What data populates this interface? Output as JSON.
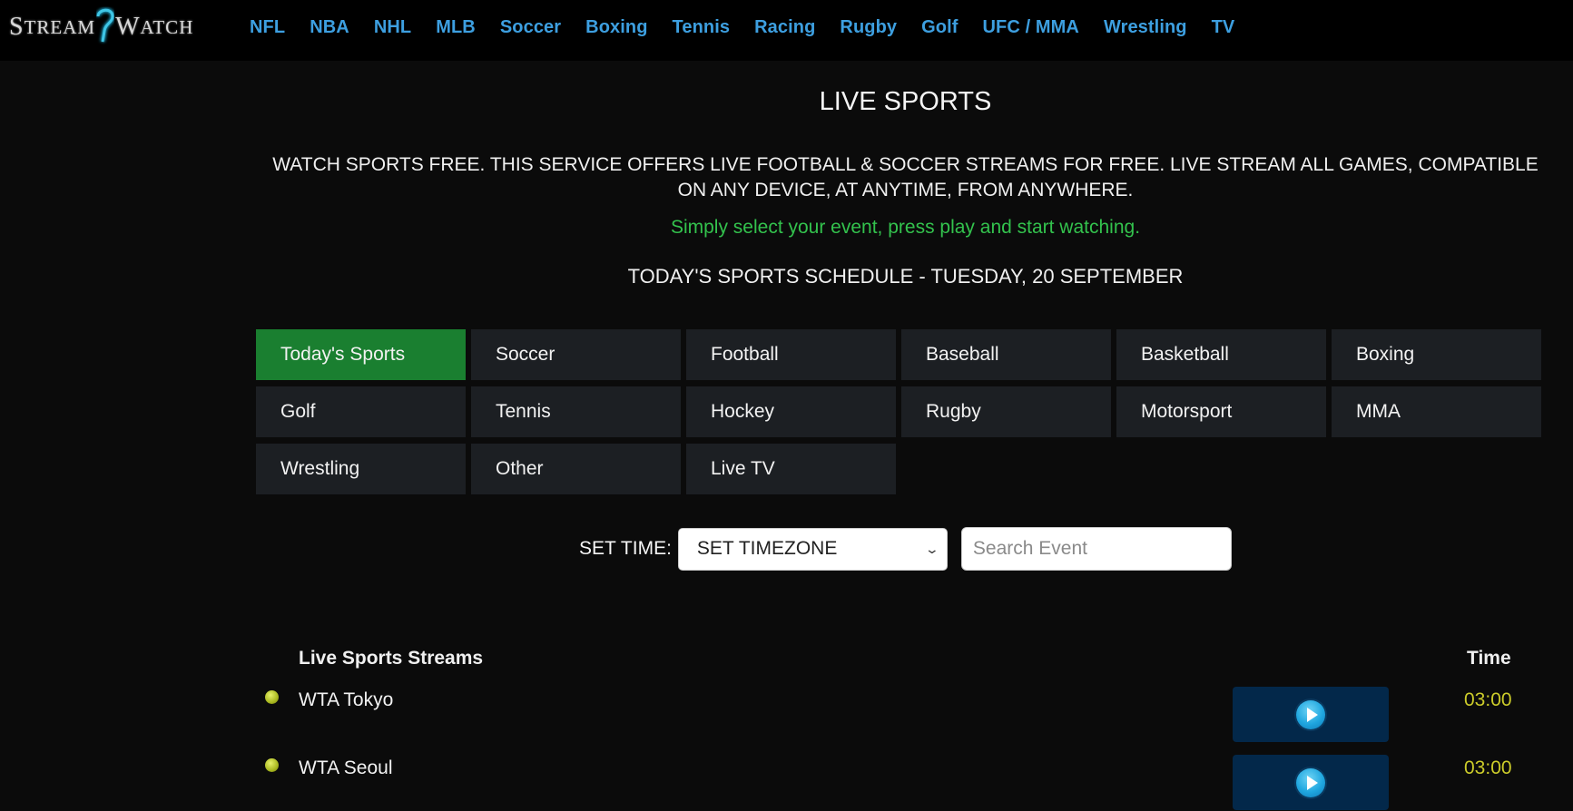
{
  "header": {
    "logo": {
      "part1_big": "S",
      "part1_small": "TREAM",
      "part2_big": "W",
      "part2_small": "ATCH"
    },
    "nav": [
      "NFL",
      "NBA",
      "NHL",
      "MLB",
      "Soccer",
      "Boxing",
      "Tennis",
      "Racing",
      "Rugby",
      "Golf",
      "UFC / MMA",
      "Wrestling",
      "TV"
    ]
  },
  "hero": {
    "title": "LIVE SPORTS",
    "intro": "WATCH SPORTS FREE. THIS SERVICE OFFERS LIVE FOOTBALL & SOCCER STREAMS FOR FREE. LIVE STREAM ALL GAMES, COMPATIBLE ON ANY DEVICE, AT ANYTIME, FROM ANYWHERE.",
    "tagline": "Simply select your event, press play and start watching.",
    "schedule": "TODAY'S SPORTS SCHEDULE - TUESDAY, 20 SEPTEMBER"
  },
  "categories": [
    {
      "label": "Today's Sports",
      "active": true
    },
    {
      "label": "Soccer"
    },
    {
      "label": "Football"
    },
    {
      "label": "Baseball"
    },
    {
      "label": "Basketball"
    },
    {
      "label": "Boxing"
    },
    {
      "label": "Golf"
    },
    {
      "label": "Tennis"
    },
    {
      "label": "Hockey"
    },
    {
      "label": "Rugby"
    },
    {
      "label": "Motorsport"
    },
    {
      "label": "MMA"
    },
    {
      "label": "Wrestling"
    },
    {
      "label": "Other"
    },
    {
      "label": "Live TV"
    }
  ],
  "filters": {
    "label": "SET TIME:",
    "timezone_selected": "SET TIMEZONE",
    "search_placeholder": "Search Event",
    "search_value": ""
  },
  "streams": {
    "heading": "Live Sports Streams",
    "time_heading": "Time",
    "events": [
      {
        "name": "WTA Tokyo",
        "time": "03:00",
        "icon": "tennis-ball-icon"
      },
      {
        "name": "WTA Seoul",
        "time": "03:00",
        "icon": "tennis-ball-icon"
      }
    ]
  },
  "colors": {
    "nav_link": "#3d9fe0",
    "active_category": "#1a7f30",
    "category_bg": "#1c1f23",
    "tagline": "#33c24d",
    "time": "#cccc2a",
    "play_button_bg": "#03284a"
  }
}
